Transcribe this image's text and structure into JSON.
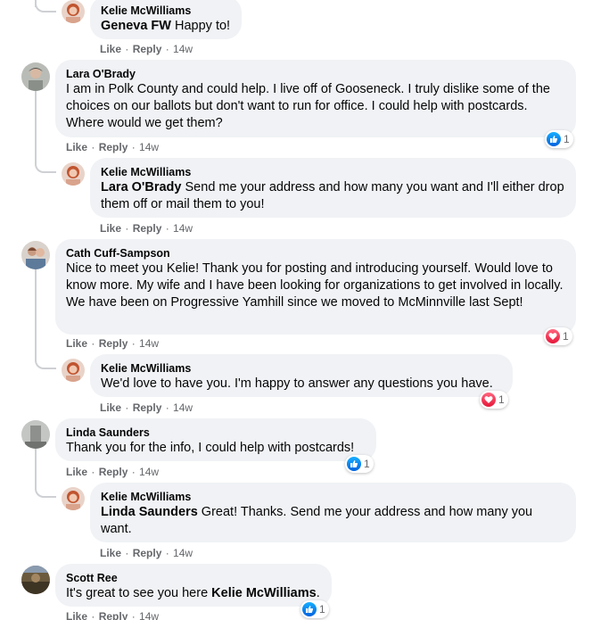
{
  "comments": {
    "c0": {
      "author": "Kelie McWilliams",
      "mention": "Geneva FW",
      "text": " Happy to!",
      "like": "Like",
      "reply": "Reply",
      "time": "14w"
    },
    "c1": {
      "author": "Lara O'Brady",
      "text": "I am in Polk County and could help. I live off of Gooseneck. I truly dislike some of the choices on our ballots but don't want to run for office. I could help with postcards. Where would we get them?",
      "like": "Like",
      "reply": "Reply",
      "time": "14w",
      "reaction": "like",
      "reaction_count": "1"
    },
    "c2": {
      "author": "Kelie McWilliams",
      "mention": "Lara O'Brady",
      "text": " Send me your address and how many you want and I'll either drop them off or mail them to you!",
      "like": "Like",
      "reply": "Reply",
      "time": "14w"
    },
    "c3": {
      "author": "Cath Cuff-Sampson",
      "text": "Nice to meet you Kelie! Thank you for posting and introducing yourself. Would love to know more. My wife and I have been looking for organizations to get involved in locally. We have been on Progressive Yamhill since we moved to McMinnville last Sept!",
      "like": "Like",
      "reply": "Reply",
      "time": "14w",
      "reaction": "love",
      "reaction_count": "1"
    },
    "c4": {
      "author": "Kelie McWilliams",
      "text": "We'd love to have you. I'm happy to answer any questions you have.",
      "like": "Like",
      "reply": "Reply",
      "time": "14w",
      "reaction": "love",
      "reaction_count": "1"
    },
    "c5": {
      "author": "Linda Saunders",
      "text": "Thank you for the info, I could help with postcards!",
      "like": "Like",
      "reply": "Reply",
      "time": "14w",
      "reaction": "like",
      "reaction_count": "1"
    },
    "c6": {
      "author": "Kelie McWilliams",
      "mention": "Linda Saunders",
      "text": " Great! Thanks. Send me your address and how many you want.",
      "like": "Like",
      "reply": "Reply",
      "time": "14w"
    },
    "c7": {
      "author": "Scott Ree",
      "text_before": "It's great to see you here ",
      "mention": "Kelie McWilliams",
      "text_after": ".",
      "like": "Like",
      "reply": "Reply",
      "time": "14w",
      "reaction": "like",
      "reaction_count": "1"
    }
  },
  "colors": {
    "bubble": "#f0f2f5",
    "meta": "#65676b",
    "like": "#0062df",
    "love": "#e61739"
  },
  "icons": {
    "like": "thumbs-up-icon",
    "love": "heart-icon"
  }
}
